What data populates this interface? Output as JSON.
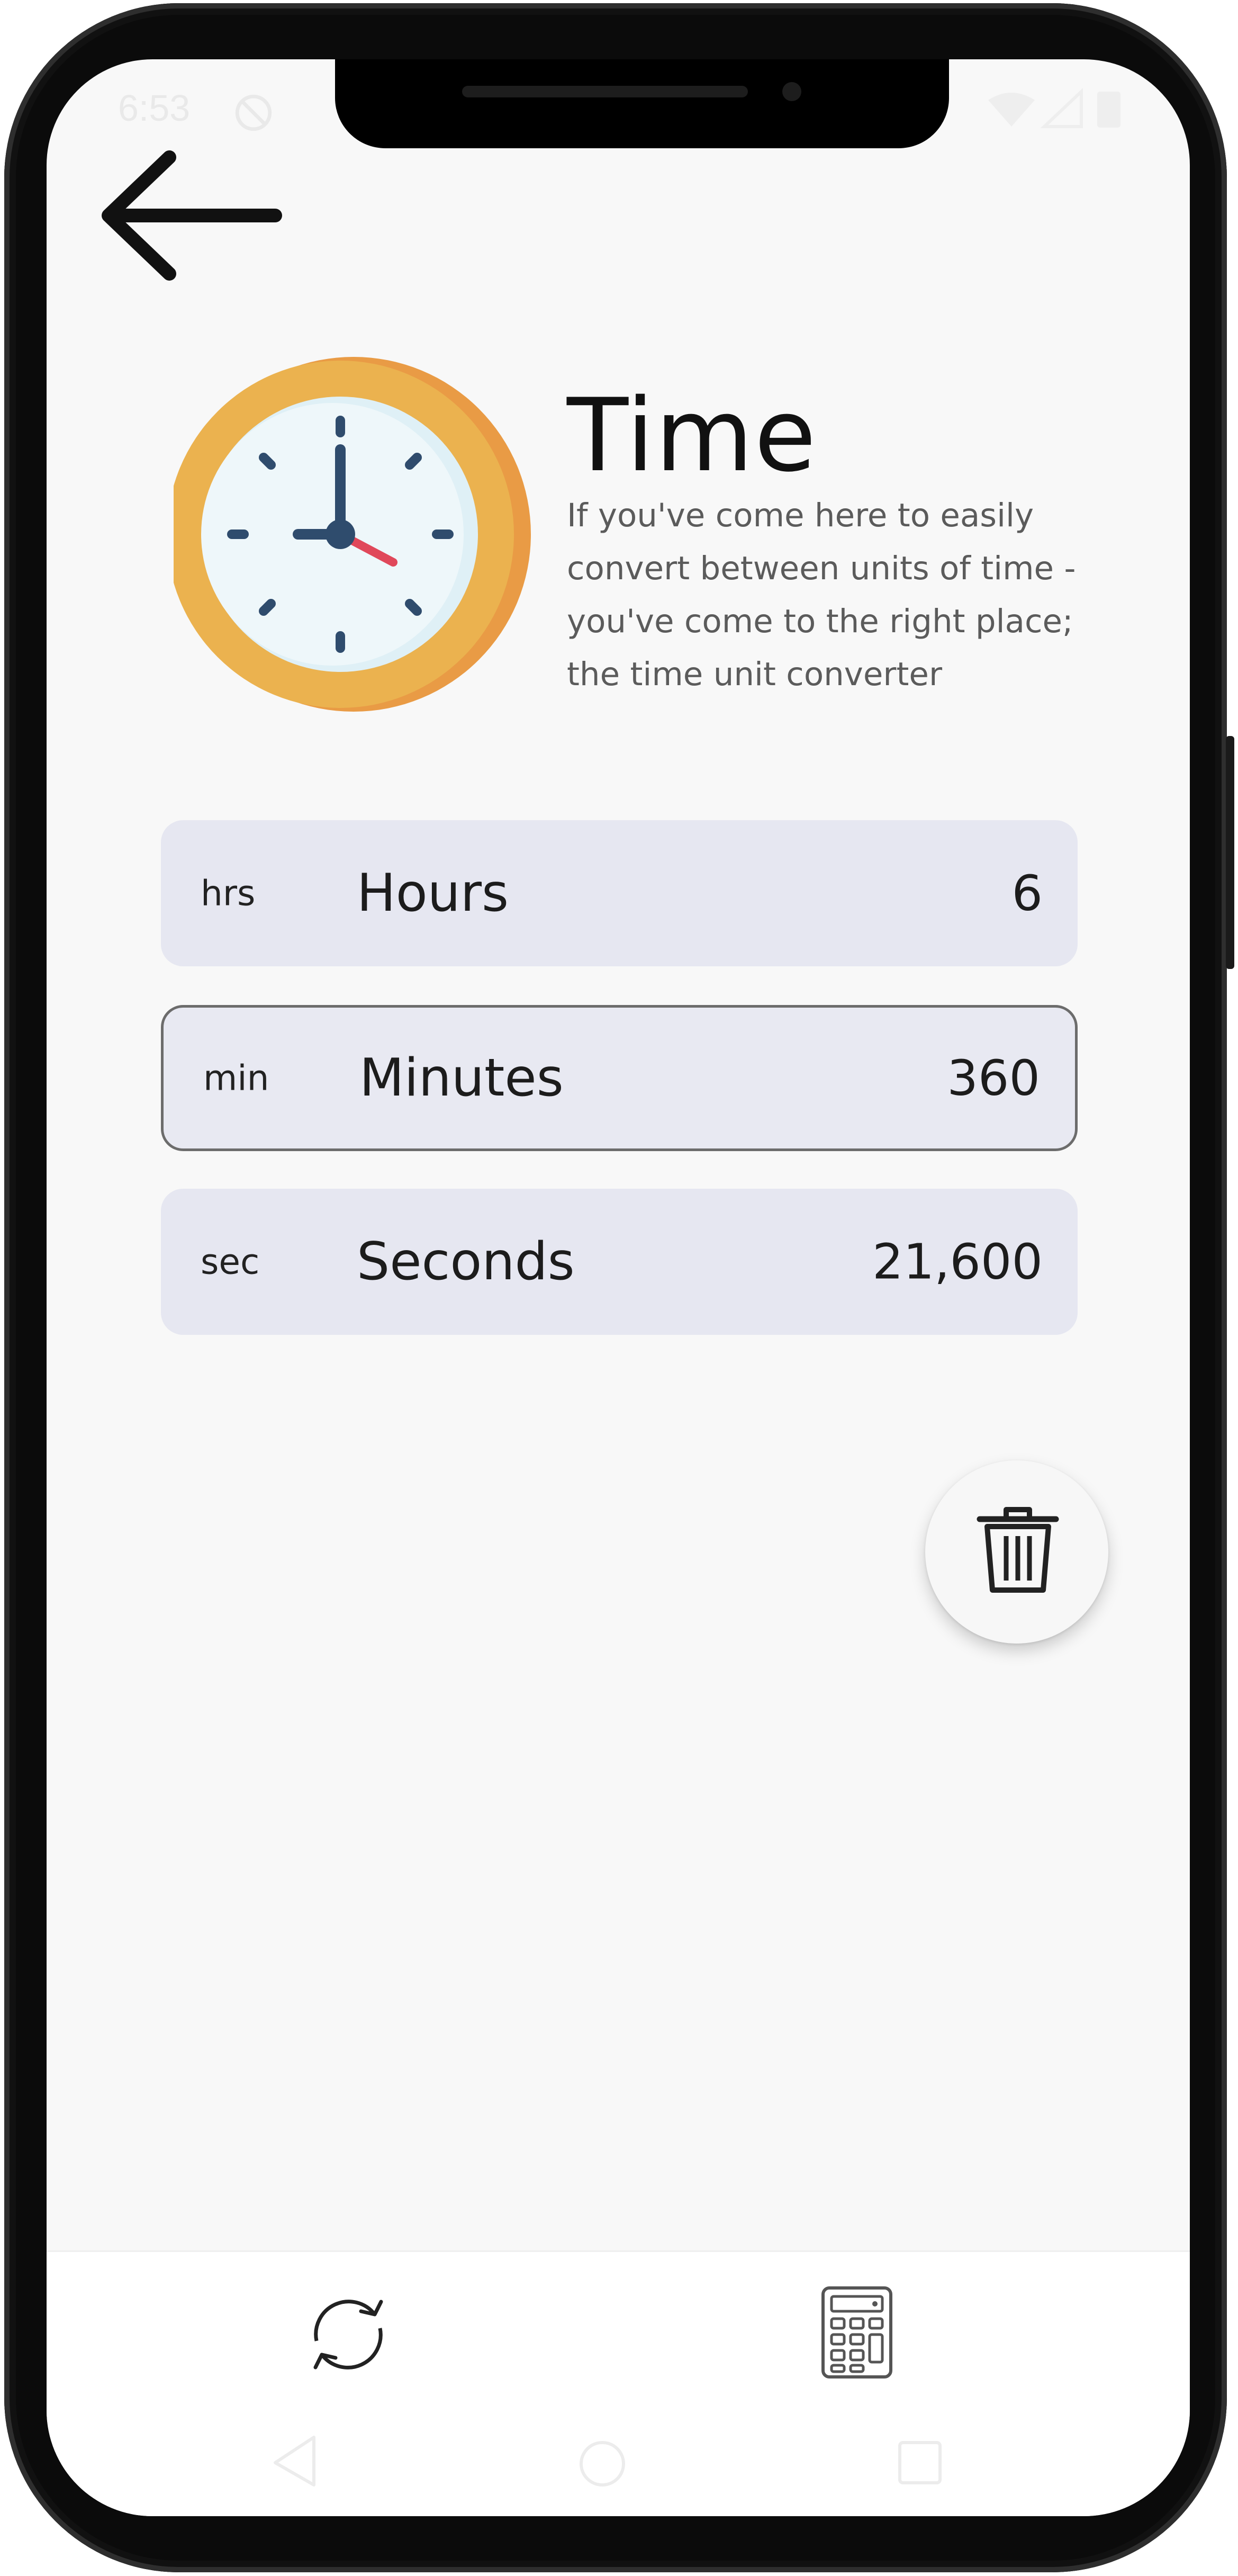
{
  "status_bar": {
    "time": "6:53",
    "icons": [
      "do-not-disturb-icon",
      "wifi-icon",
      "signal-icon",
      "battery-icon"
    ]
  },
  "header": {
    "title": "Time",
    "description": "If you've come here to easily convert between units of time - you've come to the right place; the time unit converter"
  },
  "units": [
    {
      "abbr": "hrs",
      "name": "Hours",
      "value": "6",
      "focused": false
    },
    {
      "abbr": "min",
      "name": "Minutes",
      "value": "360",
      "focused": true
    },
    {
      "abbr": "sec",
      "name": "Seconds",
      "value": "21,600",
      "focused": false
    }
  ],
  "actions": {
    "clear_icon": "trash-icon"
  },
  "bottom_nav": {
    "items": [
      "convert-icon",
      "calculator-icon"
    ]
  },
  "system_nav": [
    "back",
    "home",
    "recents"
  ],
  "colors": {
    "background": "#f8f8f8",
    "row_background": "#e6e7f1",
    "clock_rim": "#e9b04d",
    "clock_hand_accent": "#e0485a",
    "text_primary": "#111111",
    "text_secondary": "#5b5b5b"
  }
}
